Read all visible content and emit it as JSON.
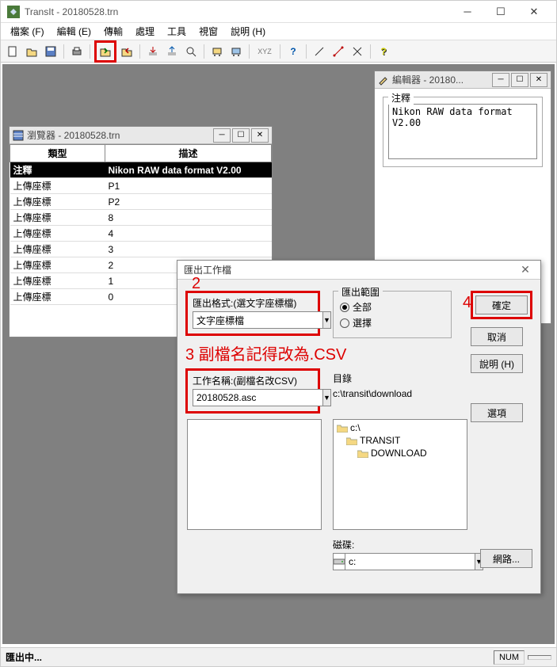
{
  "main_window": {
    "title": "TransIt - 20180528.trn"
  },
  "menubar": {
    "file": "檔案 (F)",
    "edit": "編輯 (E)",
    "transfer": "傳輸",
    "process": "處理",
    "tools": "工具",
    "window": "視窗",
    "help": "說明 (H)"
  },
  "toolbar_labels": {
    "xyz": "XYZ"
  },
  "browser": {
    "title": "瀏覽器 - 20180528.trn",
    "col_type": "類型",
    "col_desc": "描述",
    "rows": [
      {
        "type": "注釋",
        "desc": "Nikon RAW data format V2.00"
      },
      {
        "type": "上傳座標",
        "desc": "P1"
      },
      {
        "type": "上傳座標",
        "desc": "P2"
      },
      {
        "type": "上傳座標",
        "desc": "8"
      },
      {
        "type": "上傳座標",
        "desc": "4"
      },
      {
        "type": "上傳座標",
        "desc": "3"
      },
      {
        "type": "上傳座標",
        "desc": "2"
      },
      {
        "type": "上傳座標",
        "desc": "1"
      },
      {
        "type": "上傳座標",
        "desc": "0"
      }
    ]
  },
  "editor": {
    "title": "編輯器 - 20180...",
    "group_label": "注釋",
    "content": "Nikon RAW data format V2.00"
  },
  "dialog": {
    "title": "匯出工作檔",
    "format_label": "匯出格式:(選文字座標檔)",
    "format_value": "文字座標檔",
    "range_label": "匯出範圍",
    "range_all": "全部",
    "range_select": "選擇",
    "jobname_label": "工作名稱:(副檔名改CSV)",
    "jobname_value": "20180528.asc",
    "dir_label": "目錄",
    "dir_value": "c:\\transit\\download",
    "tree": {
      "root": "c:\\",
      "n1": "TRANSIT",
      "n2": "DOWNLOAD"
    },
    "drive_label": "磁碟:",
    "drive_value": "c:",
    "btn_ok": "確定",
    "btn_cancel": "取消",
    "btn_help": "說明 (H)",
    "btn_options": "選項",
    "btn_network": "網路..."
  },
  "annotations": {
    "n2": "2",
    "n3": "3 副檔名記得改為.CSV",
    "n4": "4"
  },
  "statusbar": {
    "msg": "匯出中...",
    "num": "NUM"
  }
}
